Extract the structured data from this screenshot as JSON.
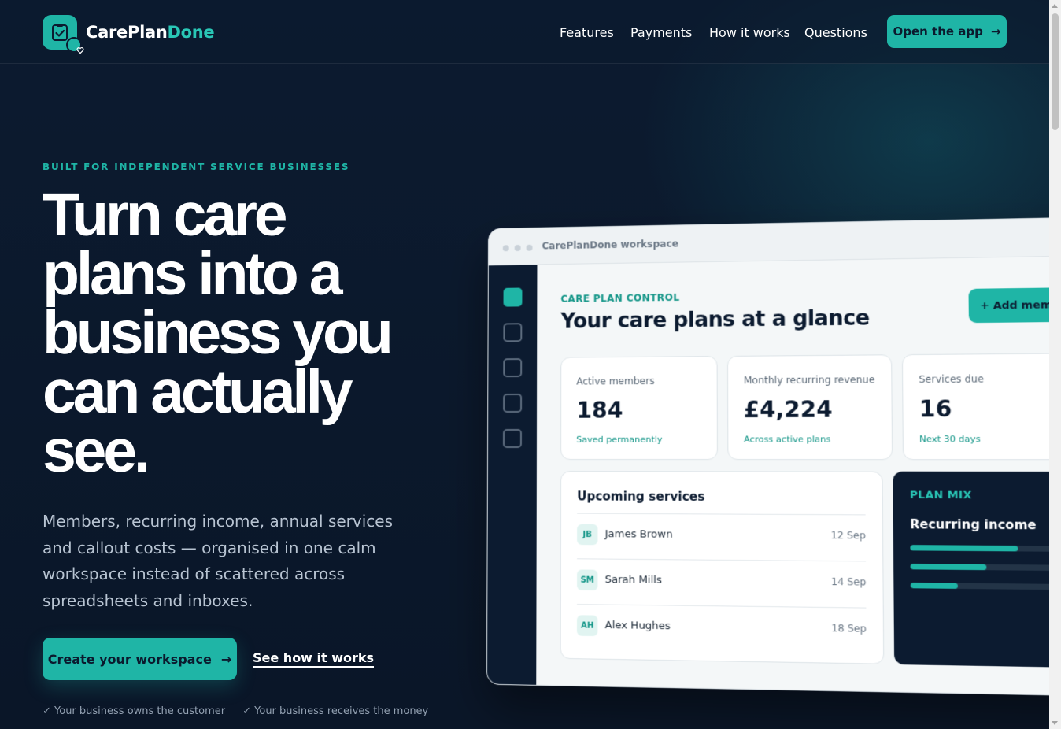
{
  "brand": {
    "name_part1": "CarePlan",
    "name_part2": "Done"
  },
  "nav": {
    "items": [
      "Features",
      "Payments",
      "How it works",
      "Questions"
    ],
    "cta_label": "Open the app",
    "cta_arrow": "→"
  },
  "hero": {
    "eyebrow": "BUILT FOR INDEPENDENT SERVICE BUSINESSES",
    "headline_lines": [
      "Turn care",
      "plans into a",
      "business you",
      "can actually",
      "see."
    ],
    "subtext": "Members, recurring income, annual services and callout costs — organised in one calm workspace instead of scattered across spreadsheets and inboxes.",
    "primary_cta": "Create your workspace",
    "primary_arrow": "→",
    "secondary_cta": "See how it works",
    "checks": [
      "✓ Your business owns the customer",
      "✓ Your business receives the money"
    ]
  },
  "workspace": {
    "window_title": "CarePlanDone workspace",
    "eyebrow": "CARE PLAN CONTROL",
    "title": "Your care plans at a glance",
    "add_button": "+ Add member",
    "stats": [
      {
        "label": "Active members",
        "value": "184",
        "note": "Saved permanently"
      },
      {
        "label": "Monthly recurring revenue",
        "value": "£4,224",
        "note": "Across active plans"
      },
      {
        "label": "Services due",
        "value": "16",
        "note": "Next 30 days"
      }
    ],
    "upcoming": {
      "title": "Upcoming services",
      "rows": [
        {
          "initials": "JB",
          "name": "James Brown",
          "date": "12 Sep"
        },
        {
          "initials": "SM",
          "name": "Sarah Mills",
          "date": "14 Sep"
        },
        {
          "initials": "AH",
          "name": "Alex Hughes",
          "date": "18 Sep"
        }
      ]
    },
    "plan_mix": {
      "eyebrow": "PLAN MIX",
      "title": "Recurring income",
      "bars": [
        0.72,
        0.51,
        0.32
      ]
    }
  },
  "colors": {
    "accent": "#1fb5a6",
    "navy": "#0c1b30"
  }
}
